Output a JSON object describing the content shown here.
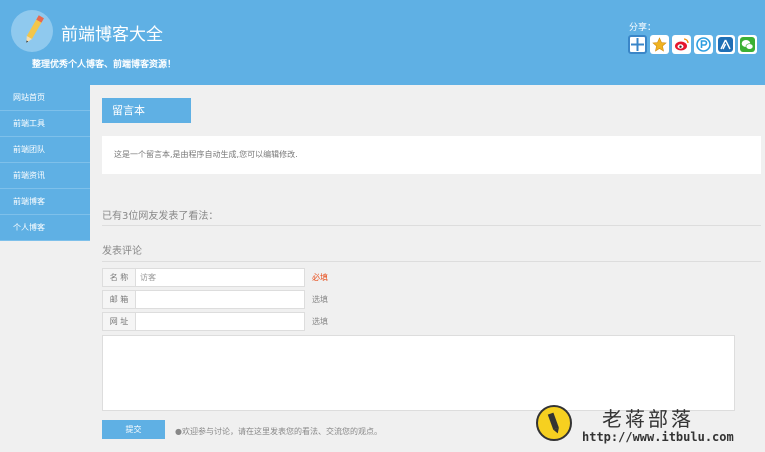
{
  "header": {
    "title": "前端博客大全",
    "slogan": "整理优秀个人博客、前端博客资源！",
    "share_label": "分享：",
    "share_icons": [
      "add-share",
      "qzone",
      "weibo",
      "pengyou",
      "renren",
      "wechat"
    ]
  },
  "sidebar": {
    "items": [
      {
        "label": "网站首页"
      },
      {
        "label": "前端工具"
      },
      {
        "label": "前端团队"
      },
      {
        "label": "前端资讯"
      },
      {
        "label": "前端博客"
      },
      {
        "label": "个人博客"
      }
    ]
  },
  "main": {
    "page_title": "留言本",
    "notice": "这是一个留言本,是由程序自动生成,您可以编辑修改.",
    "comment_count": "已有3位网友发表了看法：",
    "comment_heading": "发表评论"
  },
  "form": {
    "name_label": "名 称",
    "name_value": "访客",
    "name_hint": "必填",
    "email_label": "邮 箱",
    "email_hint": "选填",
    "url_label": "网 址",
    "url_hint": "选填",
    "submit_label": "提交",
    "submit_tip": "●欢迎参与讨论，请在这里发表您的看法、交流您的观点。"
  },
  "watermark": {
    "name": "老蒋部落",
    "url": "http://www.itbulu.com"
  },
  "colors": {
    "accent": "#5fb0e4",
    "required": "#e8501e"
  }
}
